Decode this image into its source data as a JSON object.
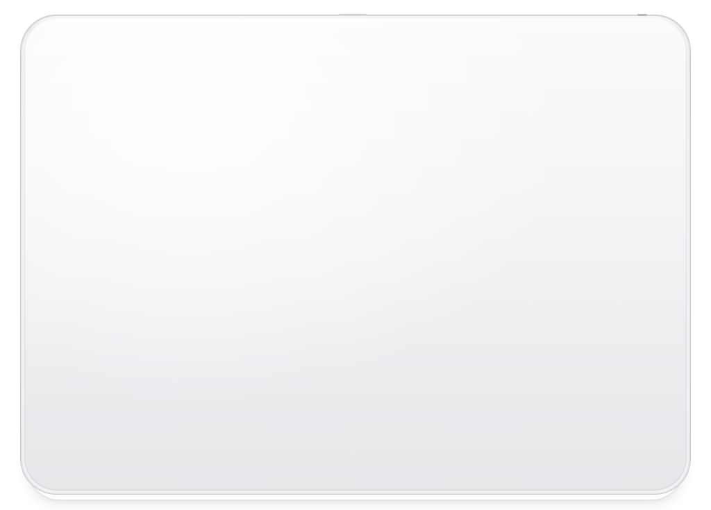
{
  "scene": {
    "subject": "trackpad",
    "colors": {
      "background": "#ffffff",
      "surface_top": "#fbfbfc",
      "surface_bottom": "#e8e8eb",
      "rim": "#e4e4e7"
    }
  }
}
